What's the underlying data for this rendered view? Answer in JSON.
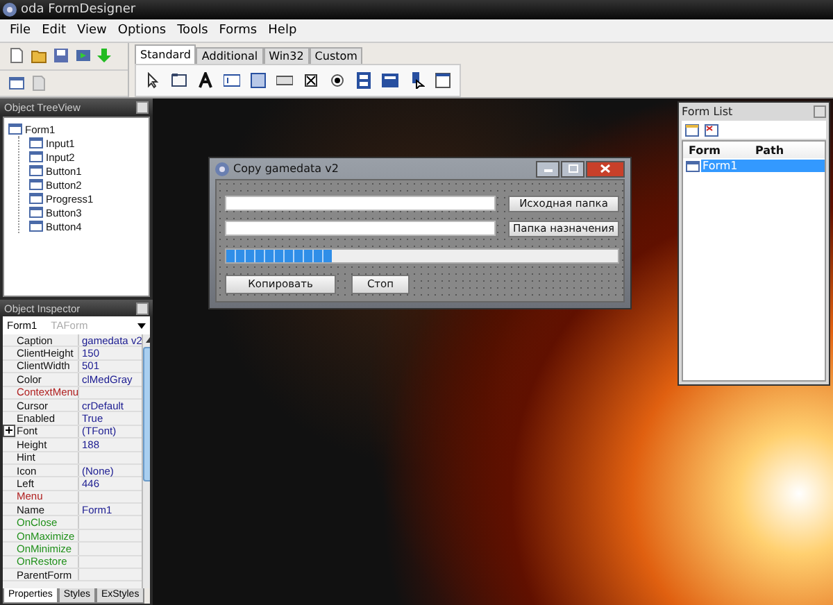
{
  "app": {
    "title": "oda FormDesigner"
  },
  "menu": [
    "File",
    "Edit",
    "View",
    "Options",
    "Tools",
    "Forms",
    "Help"
  ],
  "palette_tabs": [
    {
      "label": "Standard",
      "selected": true
    },
    {
      "label": "Additional",
      "selected": false
    },
    {
      "label": "Win32",
      "selected": false
    },
    {
      "label": "Custom",
      "selected": false
    }
  ],
  "tree_view": {
    "title": "Object TreeView",
    "root": {
      "label": "Form1",
      "children": [
        {
          "label": "Input1"
        },
        {
          "label": "Input2"
        },
        {
          "label": "Button1"
        },
        {
          "label": "Button2"
        },
        {
          "label": "Progress1"
        },
        {
          "label": "Button3"
        },
        {
          "label": "Button4"
        }
      ]
    }
  },
  "inspector": {
    "title": "Object Inspector",
    "object_name": "Form1",
    "object_type": "TAForm",
    "properties": [
      {
        "name": "Caption",
        "value": "gamedata v2",
        "kind": "property"
      },
      {
        "name": "ClientHeight",
        "value": "150",
        "kind": "property"
      },
      {
        "name": "ClientWidth",
        "value": "501",
        "kind": "property"
      },
      {
        "name": "Color",
        "value": "clMedGray",
        "kind": "property"
      },
      {
        "name": "ContextMenu",
        "kind": "reference"
      },
      {
        "name": "Cursor",
        "value": "crDefault",
        "kind": "property"
      },
      {
        "name": "Enabled",
        "value": "True",
        "kind": "property"
      },
      {
        "name": "Font",
        "value": "(TFont)",
        "kind": "property",
        "expanded": false
      },
      {
        "name": "Height",
        "value": "188",
        "kind": "property"
      },
      {
        "name": "Hint",
        "kind": "property"
      },
      {
        "name": "Icon",
        "value": "(None)",
        "kind": "property"
      },
      {
        "name": "Left",
        "value": "446",
        "kind": "property"
      },
      {
        "name": "Menu",
        "kind": "reference"
      },
      {
        "name": "Name",
        "value": "Form1",
        "kind": "property"
      },
      {
        "name": "OnClose",
        "kind": "event"
      },
      {
        "name": "OnMaximize",
        "kind": "event"
      },
      {
        "name": "OnMinimize",
        "kind": "event"
      },
      {
        "name": "OnRestore",
        "kind": "event"
      },
      {
        "name": "ParentForm",
        "kind": "property"
      }
    ],
    "tabs": [
      {
        "label": "Properties",
        "selected": true
      },
      {
        "label": "Styles",
        "selected": false
      },
      {
        "label": "ExStyles",
        "selected": false
      }
    ]
  },
  "dialog": {
    "title": "Copy gamedata v2",
    "folder_buttons": [
      "Исходная папка",
      "Папка назначения"
    ],
    "progress": {
      "level": 0.27
    },
    "buttons": [
      "Копировать",
      "Стоп"
    ]
  },
  "form_list": {
    "title": "Form List",
    "columns": [
      "Form",
      "Path"
    ],
    "rows": [
      {
        "form": "Form1",
        "selected": true
      }
    ]
  }
}
